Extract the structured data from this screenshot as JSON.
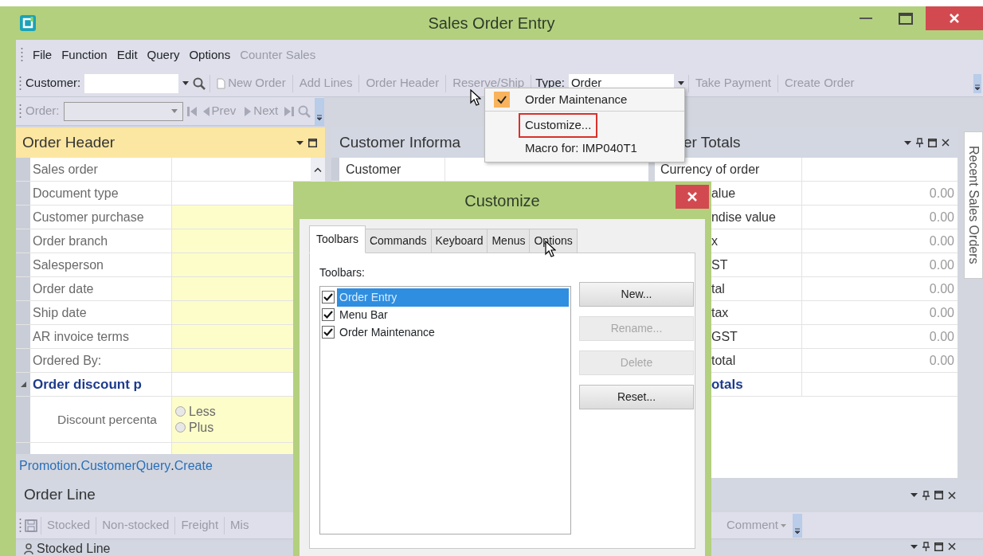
{
  "window": {
    "title": "Sales Order Entry"
  },
  "menu_bar": [
    {
      "label": "File",
      "disabled": false
    },
    {
      "label": "Function",
      "disabled": false
    },
    {
      "label": "Edit",
      "disabled": false
    },
    {
      "label": "Query",
      "disabled": false
    },
    {
      "label": "Options",
      "disabled": false
    },
    {
      "label": "Counter Sales",
      "disabled": true
    }
  ],
  "toolbar_main": {
    "customer_label": "Customer:",
    "buttons": [
      {
        "label": "New Order",
        "disabled": true
      },
      {
        "label": "Add Lines",
        "disabled": true
      },
      {
        "label": "Order Header",
        "disabled": true
      },
      {
        "label": "Reserve/Ship",
        "disabled": true
      }
    ],
    "type_label": "Type:",
    "type_value": "Order",
    "actions": [
      {
        "label": "Take Payment",
        "disabled": true
      },
      {
        "label": "Create Order",
        "disabled": true
      }
    ]
  },
  "toolbar_nav": {
    "order_label": "Order:",
    "disabled": true,
    "buttons": [
      {
        "label": "Prev"
      },
      {
        "label": "Next"
      }
    ]
  },
  "order_header": {
    "title": "Order Header",
    "rows": [
      {
        "label": "Sales order",
        "required": false
      },
      {
        "label": "Document type",
        "required": false
      },
      {
        "label": "Customer purchase",
        "required": true
      },
      {
        "label": "Order branch",
        "required": true
      },
      {
        "label": "Salesperson",
        "required": true
      },
      {
        "label": "Order date",
        "required": true
      },
      {
        "label": "Ship date",
        "required": true
      },
      {
        "label": "AR invoice terms",
        "required": true
      },
      {
        "label": "Ordered By:",
        "required": true
      }
    ],
    "group": {
      "label": "Order discount p",
      "expanded": true
    },
    "discount": {
      "label": "Discount percenta",
      "options": [
        {
          "label": "Less",
          "selected": false
        },
        {
          "label": "Plus",
          "selected": false
        }
      ]
    },
    "links": [
      {
        "label": "Promotion",
        "suffix": "."
      },
      {
        "label": "CustomerQuery",
        "suffix": "."
      },
      {
        "label": "Create"
      }
    ]
  },
  "customer_info": {
    "title": "Customer Informa",
    "rows": [
      {
        "label": "Customer"
      }
    ]
  },
  "order_totals": {
    "title": "er Totals",
    "rows": [
      {
        "label": "Currency of order",
        "kind": "field"
      },
      {
        "label": "alue",
        "value": "0.00",
        "kind": "field"
      },
      {
        "label": "ndise value",
        "value": "0.00",
        "kind": "field"
      },
      {
        "label": "x",
        "value": "0.00",
        "kind": "field"
      },
      {
        "label": "ST",
        "value": "0.00",
        "kind": "field"
      },
      {
        "label": "tal",
        "value": "0.00",
        "kind": "field"
      },
      {
        "label": "tax",
        "value": "0.00",
        "kind": "field"
      },
      {
        "label": "GST",
        "value": "0.00",
        "kind": "field"
      },
      {
        "label": "total",
        "value": "0.00",
        "kind": "field"
      },
      {
        "label": "otals",
        "kind": "group"
      }
    ]
  },
  "side_tab": {
    "label": "Recent Sales Orders"
  },
  "order_line": {
    "title": "Order Line",
    "tools": [
      {
        "label": "Stocked"
      },
      {
        "label": "Non-stocked"
      },
      {
        "label": "Freight"
      },
      {
        "label": "Mis"
      }
    ],
    "comment": "Comment"
  },
  "stocked_line": {
    "title": "Stocked Line"
  },
  "context_menu": {
    "items": [
      {
        "label": "Order Maintenance",
        "checked": true,
        "highlighted": false,
        "separator_after": true
      },
      {
        "label": "Customize...",
        "checked": false,
        "highlighted": true,
        "separator_after": false
      },
      {
        "label": "Macro for: IMP040T1",
        "checked": false,
        "highlighted": false,
        "separator_after": false
      }
    ]
  },
  "dialog": {
    "title": "Customize",
    "tabs": [
      {
        "label": "Toolbars",
        "selected": true
      },
      {
        "label": "Commands",
        "selected": false
      },
      {
        "label": "Keyboard",
        "selected": false
      },
      {
        "label": "Menus",
        "selected": false
      },
      {
        "label": "Options",
        "selected": false
      }
    ],
    "list_label": "Toolbars:",
    "toolbars": [
      {
        "label": "Order Entry",
        "checked": true,
        "selected": true
      },
      {
        "label": "Menu Bar",
        "checked": true,
        "selected": false
      },
      {
        "label": "Order Maintenance",
        "checked": true,
        "selected": false
      }
    ],
    "buttons": [
      {
        "label": "New...",
        "disabled": false
      },
      {
        "label": "Rename...",
        "disabled": true
      },
      {
        "label": "Delete",
        "disabled": true
      },
      {
        "label": "Reset...",
        "disabled": false
      }
    ]
  }
}
